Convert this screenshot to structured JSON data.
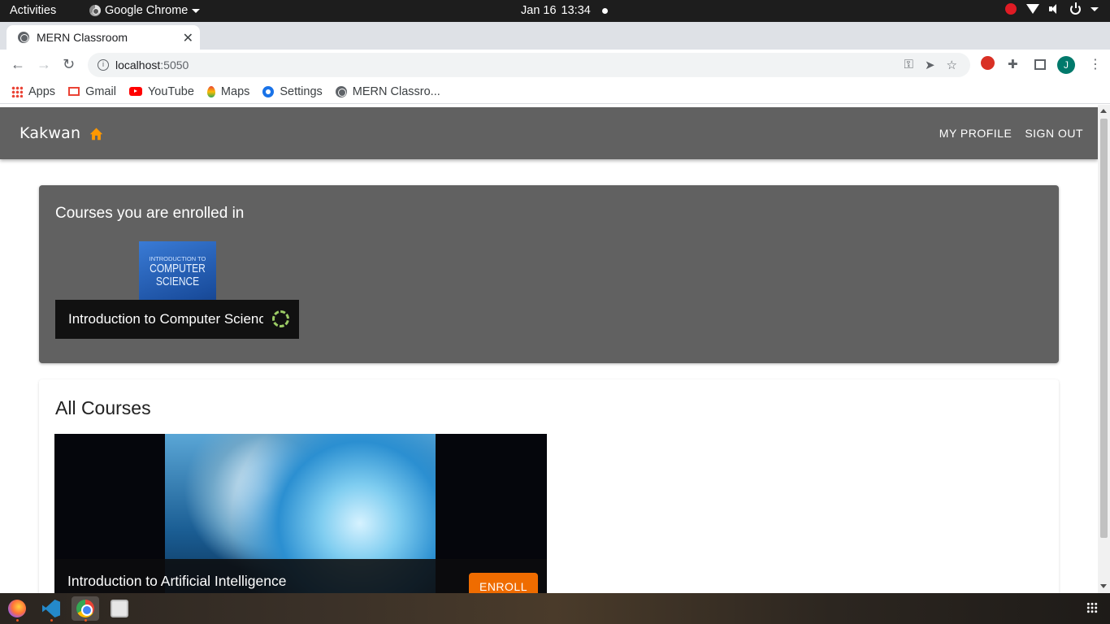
{
  "system_bar": {
    "activities": "Activities",
    "app_name": "Google Chrome",
    "date": "Jan 16",
    "time": "13:34"
  },
  "browser": {
    "tab_title": "MERN Classroom",
    "url_host": "localhost",
    "url_port": ":5050",
    "profile_initial": "J",
    "bookmarks": [
      {
        "label": "Apps",
        "icon": "apps-grid-icon"
      },
      {
        "label": "Gmail",
        "icon": "gmail-icon"
      },
      {
        "label": "YouTube",
        "icon": "youtube-icon"
      },
      {
        "label": "Maps",
        "icon": "maps-pin-icon"
      },
      {
        "label": "Settings",
        "icon": "gear-icon"
      },
      {
        "label": "MERN Classro...",
        "icon": "globe-icon"
      }
    ]
  },
  "app": {
    "brand": "Kakwan",
    "nav": {
      "my_profile": "MY PROFILE",
      "sign_out": "SIGN OUT"
    },
    "enrolled": {
      "heading": "Courses you are enrolled in",
      "courses": [
        {
          "title": "Introduction to Computer Science",
          "thumb_small": "INTRODUCTION TO",
          "thumb_big_1": "COMPUTER",
          "thumb_big_2": "SCIENCE",
          "status_icon": "in-progress-icon"
        }
      ]
    },
    "all_courses": {
      "heading": "All Courses",
      "courses": [
        {
          "title": "Introduction to Artificial Intelligence",
          "action": "ENROLL"
        }
      ]
    }
  },
  "colors": {
    "appbar": "#616161",
    "accent": "#ef6c00",
    "progress": "#9ccc65"
  }
}
